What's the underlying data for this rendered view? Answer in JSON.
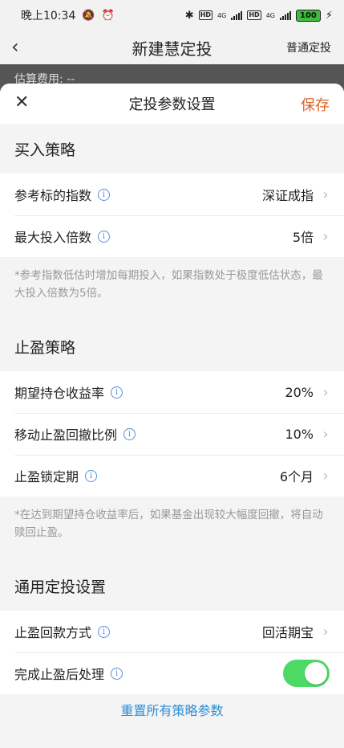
{
  "statusbar": {
    "time": "晚上10:34",
    "hd1": "HD",
    "net1": "4G",
    "hd2": "HD",
    "net2": "4G",
    "battery": "100"
  },
  "nav": {
    "title": "新建慧定投",
    "right_link": "普通定投"
  },
  "estimate": {
    "text": "估算费用: --"
  },
  "sheet": {
    "title": "定投参数设置",
    "save": "保存"
  },
  "buy_strategy": {
    "title": "买入策略",
    "rows": [
      {
        "label": "参考标的指数",
        "value": "深证成指"
      },
      {
        "label": "最大投入倍数",
        "value": "5倍"
      }
    ],
    "note": "*参考指数低估时增加每期投入，如果指数处于极度低估状态，最大投入倍数为5倍。"
  },
  "stop_strategy": {
    "title": "止盈策略",
    "rows": [
      {
        "label": "期望持仓收益率",
        "value": "20%"
      },
      {
        "label": "移动止盈回撤比例",
        "value": "10%"
      },
      {
        "label": "止盈锁定期",
        "value": "6个月"
      }
    ],
    "note": "*在达到期望持仓收益率后，如果基金出现较大幅度回撤，将自动赎回止盈。"
  },
  "general": {
    "title": "通用定投设置",
    "rows": [
      {
        "label": "止盈回款方式",
        "value": "回活期宝"
      },
      {
        "label": "完成止盈后处理",
        "toggle_on": true
      }
    ]
  },
  "reset_label": "重置所有策略参数",
  "colors": {
    "accent_orange": "#e0642a",
    "link_blue": "#2b8fd6",
    "toggle_green": "#4cd964"
  }
}
